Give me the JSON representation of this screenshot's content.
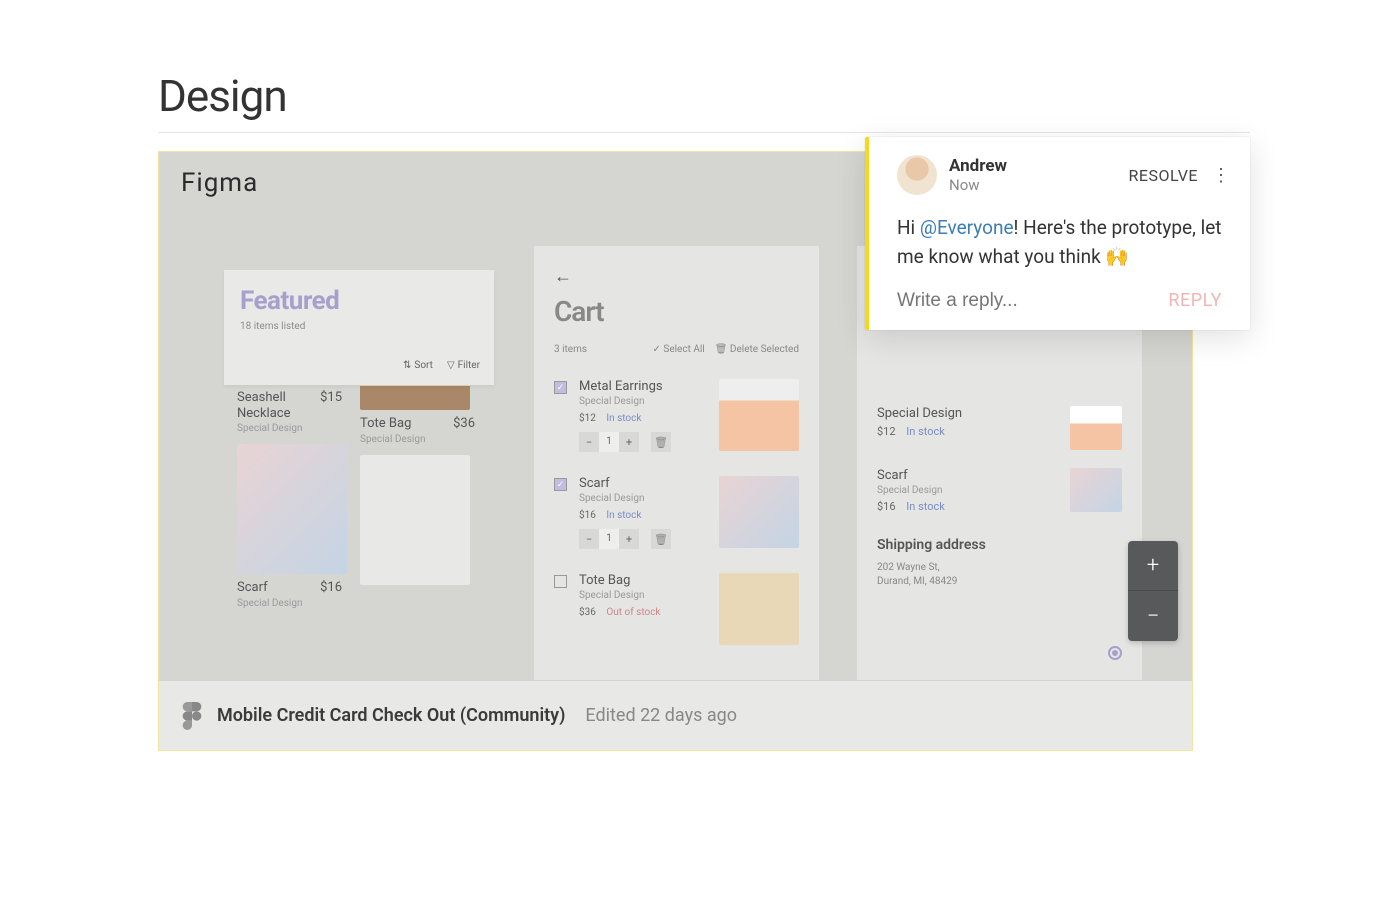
{
  "page": {
    "title": "Design"
  },
  "figma": {
    "app_label": "Figma",
    "file_name": "Mobile Credit Card Check Out (Community)",
    "edited_label": "Edited 22 days ago"
  },
  "featured": {
    "title": "Featured",
    "subtitle": "18 items listed",
    "sort_label": "Sort",
    "filter_label": "Filter"
  },
  "products": {
    "seashell": {
      "name": "Seashell Necklace",
      "sub": "Special Design",
      "price": "$15"
    },
    "tote": {
      "name": "Tote Bag",
      "sub": "Special Design",
      "price": "$36"
    },
    "scarf": {
      "name": "Scarf",
      "sub": "Special Design",
      "price": "$16"
    }
  },
  "cart": {
    "title": "Cart",
    "count": "3 items",
    "select_all": "Select All",
    "delete_selected": "Delete Selected",
    "items": [
      {
        "name": "Metal Earrings",
        "sub": "Special Design",
        "price": "$12",
        "stock": "In stock",
        "qty": "1",
        "checked": true
      },
      {
        "name": "Scarf",
        "sub": "Special Design",
        "price": "$16",
        "stock": "In stock",
        "qty": "1",
        "checked": true
      },
      {
        "name": "Tote Bag",
        "sub": "Special Design",
        "price": "$36",
        "stock": "Out of stock",
        "qty": "",
        "checked": false
      }
    ]
  },
  "summary": {
    "items": [
      {
        "name": "Special Design",
        "price": "$12",
        "stock": "In stock"
      },
      {
        "name": "Scarf",
        "sub": "Special Design",
        "price": "$16",
        "stock": "In stock"
      }
    ],
    "shipping_title": "Shipping address",
    "address_line1": "202 Wayne St,",
    "address_line2": "Durand, MI, 48429"
  },
  "comment": {
    "author": "Andrew",
    "time": "Now",
    "resolve": "RESOLVE",
    "greeting": "Hi ",
    "mention": "@Everyone",
    "body_rest": "! Here's the prototype, let me know what you think 🙌",
    "reply_placeholder": "Write a reply...",
    "reply_action": "REPLY"
  },
  "zoom": {
    "plus": "+",
    "minus": "−"
  }
}
